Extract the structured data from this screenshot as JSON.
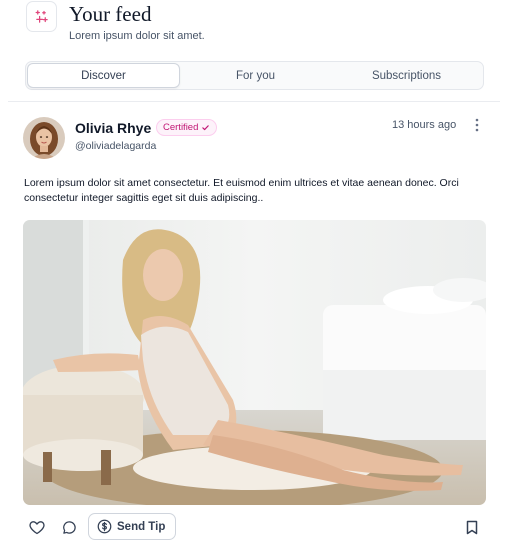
{
  "header": {
    "title": "Your feed",
    "subtitle": "Lorem ipsum dolor sit amet.",
    "icon": "sparkles-icon"
  },
  "tabs": [
    {
      "label": "Discover",
      "active": true
    },
    {
      "label": "For you",
      "active": false
    },
    {
      "label": "Subscriptions",
      "active": false
    }
  ],
  "post": {
    "author": {
      "name": "Olivia Rhye",
      "badge": "Certified",
      "handle": "@oliviadelagarda"
    },
    "timestamp": "13 hours ago",
    "text": "Lorem ipsum dolor sit amet consectetur. Et euismod enim ultrices et vitae aenean donec. Orci consectetur integer sagittis eget sit duis adipiscing..",
    "image": "photo-of-woman-reclining-on-rug"
  },
  "actions": {
    "like_icon": "heart-icon",
    "comment_icon": "comment-icon",
    "tip_label": "Send Tip",
    "tip_icon": "dollar-circle-icon",
    "bookmark_icon": "bookmark-icon"
  },
  "colors": {
    "accent": "#c11574",
    "badge_bg": "#fdf2fa",
    "icon_pink": "#e0457b"
  }
}
